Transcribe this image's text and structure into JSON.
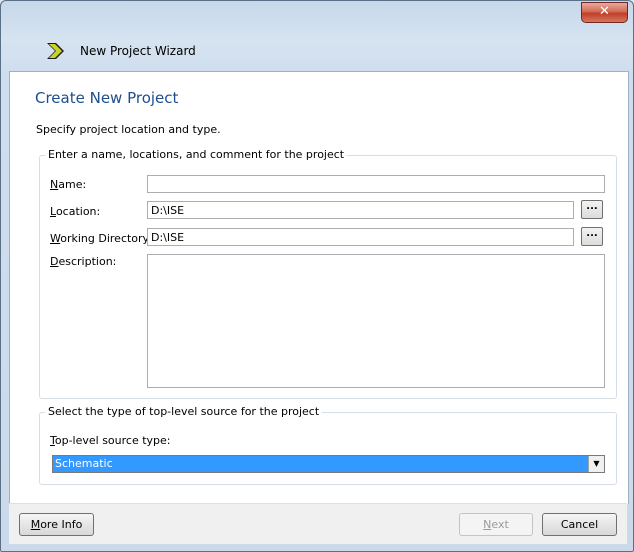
{
  "window": {
    "title": "New Project Wizard",
    "close_label": "✕",
    "ghost_text": "..."
  },
  "page": {
    "heading": "Create New Project",
    "subtitle": "Specify project location and type."
  },
  "project_group": {
    "legend": "Enter a name, locations, and comment for the project",
    "name_label": {
      "pre": "",
      "ul": "N",
      "post": "ame:"
    },
    "name_value": "",
    "location_label": {
      "pre": "",
      "ul": "L",
      "post": "ocation:"
    },
    "location_value": "D:\\ISE",
    "working_dir_label": {
      "pre": "",
      "ul": "W",
      "post": "orking Directory:"
    },
    "working_dir_value": "D:\\ISE",
    "description_label": {
      "pre": "",
      "ul": "D",
      "post": "escription:"
    },
    "browse_label": "..."
  },
  "source_group": {
    "legend": "Select the type of top-level source for the project",
    "type_label": {
      "pre": "",
      "ul": "T",
      "post": "op-level source type:"
    },
    "type_value": "Schematic"
  },
  "footer": {
    "more_info_label": {
      "pre": "",
      "ul": "M",
      "post": "ore Info"
    },
    "next_label": {
      "pre": "",
      "ul": "N",
      "post": "ext"
    },
    "cancel_label": "Cancel"
  }
}
